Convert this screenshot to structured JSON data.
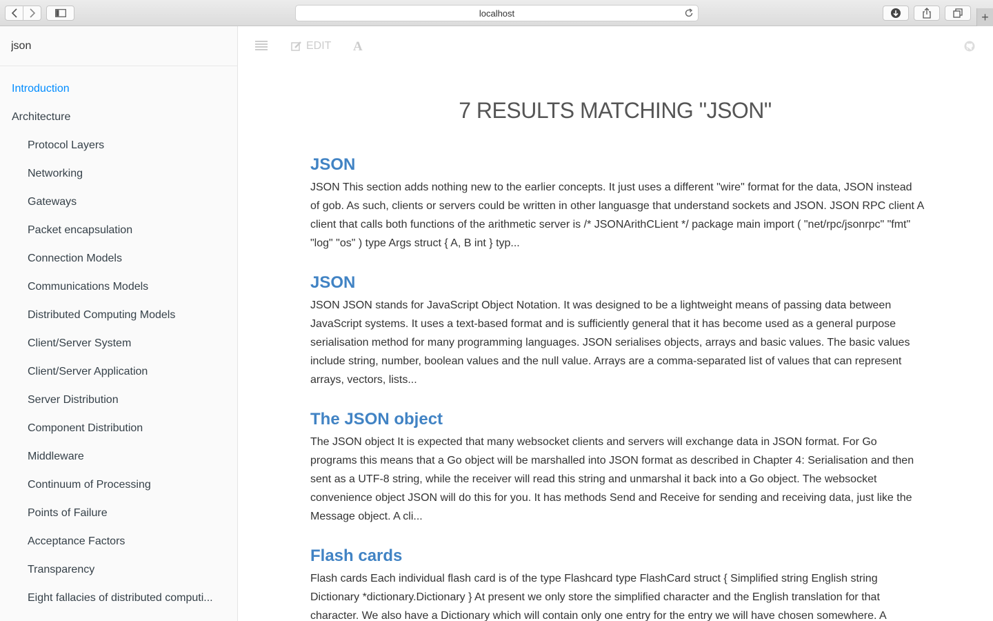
{
  "browser": {
    "url": "localhost"
  },
  "sidebar": {
    "search_value": "json",
    "items": [
      {
        "label": "Introduction",
        "level": 0,
        "active": true
      },
      {
        "label": "Architecture",
        "level": 0,
        "active": false
      },
      {
        "label": "Protocol Layers",
        "level": 1,
        "active": false
      },
      {
        "label": "Networking",
        "level": 1,
        "active": false
      },
      {
        "label": "Gateways",
        "level": 1,
        "active": false
      },
      {
        "label": "Packet encapsulation",
        "level": 1,
        "active": false
      },
      {
        "label": "Connection Models",
        "level": 1,
        "active": false
      },
      {
        "label": "Communications Models",
        "level": 1,
        "active": false
      },
      {
        "label": "Distributed Computing Models",
        "level": 1,
        "active": false
      },
      {
        "label": "Client/Server System",
        "level": 1,
        "active": false
      },
      {
        "label": "Client/Server Application",
        "level": 1,
        "active": false
      },
      {
        "label": "Server Distribution",
        "level": 1,
        "active": false
      },
      {
        "label": "Component Distribution",
        "level": 1,
        "active": false
      },
      {
        "label": "Middleware",
        "level": 1,
        "active": false
      },
      {
        "label": "Continuum of Processing",
        "level": 1,
        "active": false
      },
      {
        "label": "Points of Failure",
        "level": 1,
        "active": false
      },
      {
        "label": "Acceptance Factors",
        "level": 1,
        "active": false
      },
      {
        "label": "Transparency",
        "level": 1,
        "active": false
      },
      {
        "label": "Eight fallacies of distributed computi...",
        "level": 1,
        "active": false
      }
    ]
  },
  "toolbar": {
    "edit_label": "EDIT"
  },
  "search_results": {
    "heading": "7 RESULTS MATCHING \"JSON\"",
    "results": [
      {
        "title": "JSON",
        "body": "JSON This section adds nothing new to the earlier concepts. It just uses a different \"wire\" format for the data, JSON instead of gob. As such, clients or servers could be written in other languasge that understand sockets and JSON. JSON RPC client A client that calls both functions of the arithmetic server is /* JSONArithCLient */ package main import ( \"net/rpc/jsonrpc\" \"fmt\" \"log\" \"os\" ) type Args struct { A, B int } typ..."
      },
      {
        "title": "JSON",
        "body": "JSON JSON stands for JavaScript Object Notation. It was designed to be a lightweight means of passing data between JavaScript systems. It uses a text-based format and is sufficiently general that it has become used as a general purpose serialisation method for many programming languages. JSON serialises objects, arrays and basic values. The basic values include string, number, boolean values and the null value. Arrays are a comma-separated list of values that can represent arrays, vectors, lists..."
      },
      {
        "title": "The JSON object",
        "body": "The JSON object It is expected that many websocket clients and servers will exchange data in JSON format. For Go programs this means that a Go object will be marshalled into JSON format as described in Chapter 4: Serialisation and then sent as a UTF-8 string, while the receiver will read this string and unmarshal it back into a Go object. The websocket convenience object JSON will do this for you. It has methods Send and Receive for sending and receiving data, just like the Message object. A cli..."
      },
      {
        "title": "Flash cards",
        "body": "Flash cards Each individual flash card is of the type Flashcard type FlashCard struct { Simplified string English string Dictionary *dictionary.Dictionary } At present we only store the simplified character and the English translation for that character. We also have a Dictionary which will contain only one entry for the entry we will have chosen somewhere. A"
      }
    ]
  }
}
